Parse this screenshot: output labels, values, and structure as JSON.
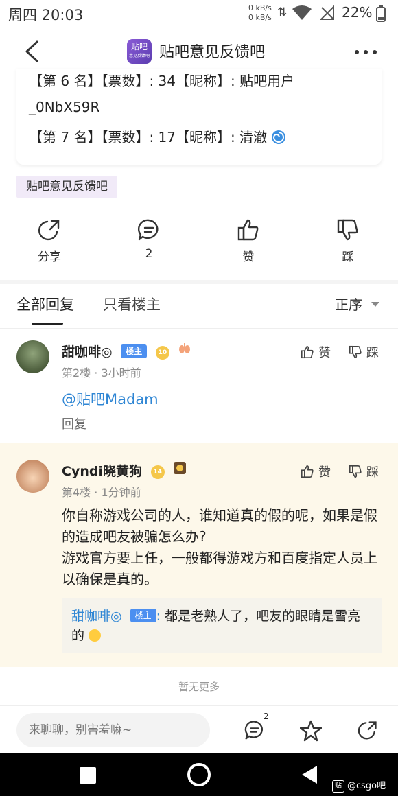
{
  "status_bar": {
    "time": "周四 20:03",
    "net_up": "0 kB/s",
    "net_down": "0 kB/s",
    "battery": "22%"
  },
  "header": {
    "title": "贴吧意见反馈吧",
    "logo_text": "贴吧",
    "logo_sub": "意见反馈吧"
  },
  "post_card": {
    "line1": "【第 6 名】【票数】: 34【昵称】: 贴吧用户",
    "line2": "_0NbX59R",
    "line3": "【第 7 名】【票数】: 17【昵称】: 清澈"
  },
  "forum_tag": "贴吧意见反馈吧",
  "actions": {
    "share": "分享",
    "comment_count": "2",
    "like": "赞",
    "dislike": "踩"
  },
  "tabs": {
    "all_replies": "全部回复",
    "op_only": "只看楼主",
    "sort": "正序"
  },
  "replies": [
    {
      "username": "甜咖啡◎",
      "host_badge": "楼主",
      "level": "10",
      "meta": "第2楼 · 3小时前",
      "content": "@贴吧Madam",
      "reply_label": "回复",
      "like": "赞",
      "dislike": "踩"
    },
    {
      "username": "Cyndi晓黄狗",
      "level": "14",
      "meta": "第4楼 · 1分钟前",
      "content": "你自称游戏公司的人，谁知道真的假的呢，如果是假的造成吧友被骗怎么办?\n游戏官方要上任，一般都得游戏方和百度指定人员上以确保是真的。",
      "like": "赞",
      "dislike": "踩",
      "sub_reply": {
        "username": "甜咖啡◎",
        "host_badge": "楼主",
        "text": "都是老熟人了，吧友的眼睛是雪亮的"
      }
    }
  ],
  "no_more": "暂无更多",
  "input_bar": {
    "placeholder": "来聊聊，别害羞嘛~",
    "comment_count": "2"
  },
  "watermark": {
    "icon_text": "贴",
    "text": "@csgo吧"
  },
  "colors": {
    "link_blue": "#2f86d4",
    "host_badge": "#4c8ff0",
    "highlight_bg": "#fdf8ea",
    "tag_bg": "#f1eaf8"
  }
}
